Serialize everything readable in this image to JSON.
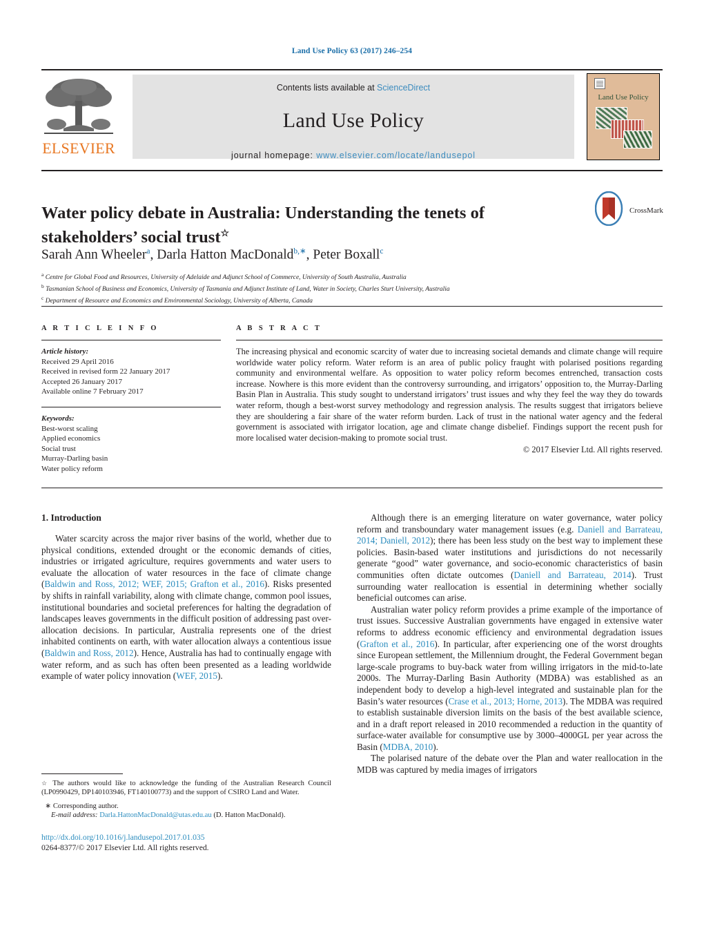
{
  "running_head": "Land Use Policy 63 (2017) 246–254",
  "masthead": {
    "contents_prefix": "Contents lists available at ",
    "sciencedirect": "ScienceDirect",
    "journal_title": "Land Use Policy",
    "homepage_label": "journal homepage: ",
    "homepage_url": "www.elsevier.com/locate/landusepol",
    "publisher_wordmark": "ELSEVIER",
    "publisher_logo_name": "elsevier-tree-logo",
    "cover_title": "Land Use Policy"
  },
  "article": {
    "title": "Water policy debate in Australia: Understanding the tenets of stakeholders’ social trust",
    "title_footnote_mark": "☆",
    "crossmark_label": "CrossMark",
    "authors": [
      {
        "name": "Sarah Ann Wheeler",
        "marks": "a"
      },
      {
        "name": "Darla Hatton MacDonald",
        "marks": "b,∗"
      },
      {
        "name": "Peter Boxall",
        "marks": "c"
      }
    ],
    "affiliations": [
      {
        "mark": "a",
        "text": "Centre for Global Food and Resources, University of Adelaide and Adjunct School of Commerce, University of South Australia, Australia"
      },
      {
        "mark": "b",
        "text": "Tasmanian School of Business and Economics, University of Tasmania and Adjunct Institute of Land, Water in Society, Charles Sturt University, Australia"
      },
      {
        "mark": "c",
        "text": "Department of Resource and Economics and Environmental Sociology, University of Alberta, Canada"
      }
    ]
  },
  "article_info": {
    "heading": "A R T I C L E   I N F O",
    "history_label": "Article history:",
    "history": [
      "Received 29 April 2016",
      "Received in revised form 22 January 2017",
      "Accepted 26 January 2017",
      "Available online 7 February 2017"
    ],
    "keywords_label": "Keywords:",
    "keywords": [
      "Best-worst scaling",
      "Applied economics",
      "Social trust",
      "Murray-Darling basin",
      "Water policy reform"
    ]
  },
  "abstract": {
    "heading": "A B S T R A C T",
    "text": "The increasing physical and economic scarcity of water due to increasing societal demands and climate change will require worldwide water policy reform. Water reform is an area of public policy fraught with polarised positions regarding community and environmental welfare. As opposition to water policy reform becomes entrenched, transaction costs increase. Nowhere is this more evident than the controversy surrounding, and irrigators’ opposition to, the Murray-Darling Basin Plan in Australia. This study sought to understand irrigators’ trust issues and why they feel the way they do towards water reform, though a best-worst survey methodology and regression analysis. The results suggest that irrigators believe they are shouldering a fair share of the water reform burden. Lack of trust in the national water agency and the federal government is associated with irrigator location, age and climate change disbelief. Findings support the recent push for more localised water decision-making to promote social trust.",
    "copyright": "© 2017 Elsevier Ltd. All rights reserved."
  },
  "body": {
    "section_number_title": "1. Introduction",
    "left_paragraphs": [
      {
        "segments": [
          {
            "t": "Water scarcity across the major river basins of the world, whether due to physical conditions, extended drought or the economic demands of cities, industries or irrigated agriculture, requires governments and water users to evaluate the allocation of water resources in the face of climate change (",
            "ref": false
          },
          {
            "t": "Baldwin and Ross, 2012; WEF, 2015; Grafton et al., 2016",
            "ref": true
          },
          {
            "t": "). Risks presented by shifts in rainfall variability, along with climate change, common pool issues, institutional boundaries and societal preferences for halting the degradation of landscapes leaves governments in the difficult position of addressing past over-allocation decisions. In particular, Australia represents one of the driest inhabited continents on earth, with water allocation always a contentious issue (",
            "ref": false
          },
          {
            "t": "Baldwin and Ross, 2012",
            "ref": true
          },
          {
            "t": "). Hence, Australia has had to continually engage with water reform, and as such has often been presented as a leading worldwide example of water policy innovation (",
            "ref": false
          },
          {
            "t": "WEF, 2015",
            "ref": true
          },
          {
            "t": ").",
            "ref": false
          }
        ]
      }
    ],
    "right_paragraphs": [
      {
        "segments": [
          {
            "t": "Although there is an emerging literature on water governance, water policy reform and transboundary water management issues (e.g. ",
            "ref": false
          },
          {
            "t": "Daniell and Barrateau, 2014; Daniell, 2012",
            "ref": true
          },
          {
            "t": "); there has been less study on the best way to implement these policies. Basin-based water institutions and jurisdictions do not necessarily generate “good” water governance, and socio-economic characteristics of basin communities often dictate outcomes (",
            "ref": false
          },
          {
            "t": "Daniell and Barrateau, 2014",
            "ref": true
          },
          {
            "t": "). Trust surrounding water reallocation is essential in determining whether socially beneficial outcomes can arise.",
            "ref": false
          }
        ]
      },
      {
        "segments": [
          {
            "t": "Australian water policy reform provides a prime example of the importance of trust issues. Successive Australian governments have engaged in extensive water reforms to address economic efficiency and environmental degradation issues (",
            "ref": false
          },
          {
            "t": "Grafton et al., 2016",
            "ref": true
          },
          {
            "t": "). In particular, after experiencing one of the worst droughts since European settlement, the Millennium drought, the Federal Government began large-scale programs to buy-back water from willing irrigators in the mid-to-late 2000s. The Murray-Darling Basin Authority (MDBA) was established as an independent body to develop a high-level integrated and sustainable plan for the Basin’s water resources (",
            "ref": false
          },
          {
            "t": "Crase et al., 2013; Horne, 2013",
            "ref": true
          },
          {
            "t": "). The MDBA was required to establish sustainable diversion limits on the basis of the best available science, and in a draft report released in 2010 recommended a reduction in the quantity of surface-water available for consumptive use by 3000–4000GL per year across the Basin (",
            "ref": false
          },
          {
            "t": "MDBA, 2010",
            "ref": true
          },
          {
            "t": ").",
            "ref": false
          }
        ]
      },
      {
        "segments": [
          {
            "t": "The polarised nature of the debate over the Plan and water reallocation in the MDB was captured by media images of irrigators",
            "ref": false
          }
        ]
      }
    ]
  },
  "footnotes": {
    "funding_mark": "☆",
    "funding_text": "The authors would like to acknowledge the funding of the Australian Research Council (LP0990429, DP140103946, FT140100773) and the support of CSIRO Land and Water.",
    "corresponding_mark": "∗",
    "corresponding_text": "Corresponding author.",
    "email_label": "E-mail address:",
    "email": "Darla.HattonMacDonald@utas.edu.au",
    "email_suffix": "(D. Hatton MacDonald).",
    "doi_url": "http://dx.doi.org/10.1016/j.landusepol.2017.01.035",
    "issn_line": "0264-8377/© 2017 Elsevier Ltd. All rights reserved."
  },
  "colors": {
    "link": "#2b8cbe",
    "running_head": "#1a6ea8",
    "elsevier_orange": "#e87722",
    "band_bg": "#e3e3e3",
    "cover_bg": "#e0bb99"
  }
}
